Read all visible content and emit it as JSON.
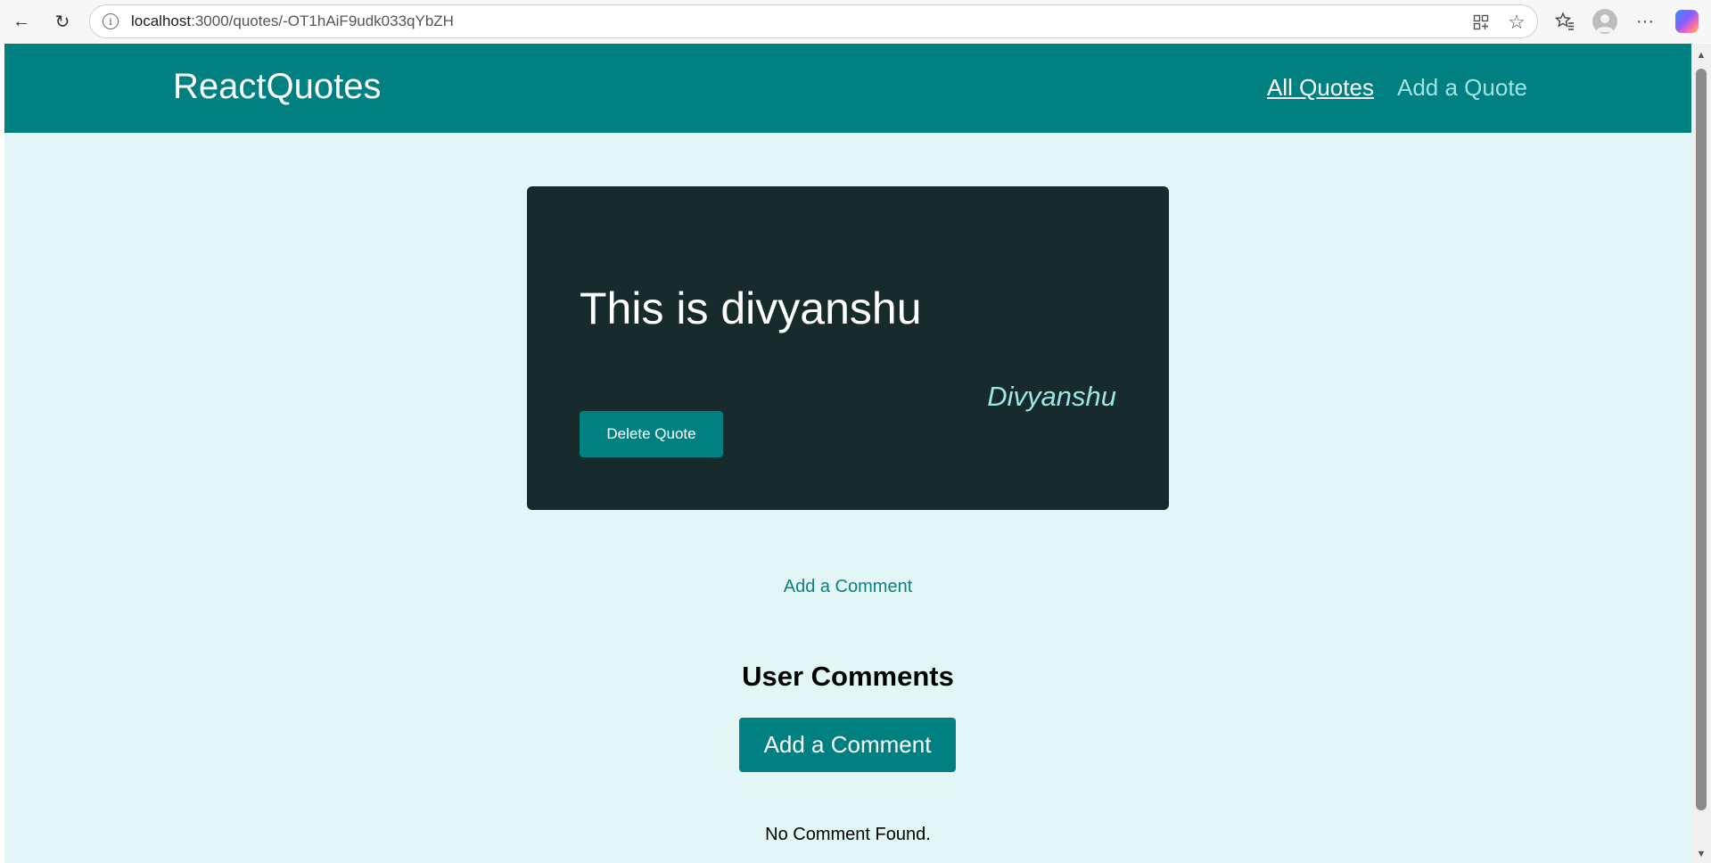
{
  "browser": {
    "url_host": "localhost",
    "url_path": ":3000/quotes/-OT1hAiF9udk033qYbZH",
    "back_glyph": "←",
    "refresh_glyph": "↻",
    "info_glyph": "i",
    "star_glyph": "☆",
    "more_glyph": "···"
  },
  "header": {
    "logo": "ReactQuotes",
    "nav": {
      "all_quotes": "All Quotes",
      "add_quote": "Add a Quote"
    }
  },
  "quote": {
    "text": "This is divyanshu",
    "author": "Divyanshu",
    "delete_label": "Delete Quote"
  },
  "comments": {
    "add_link": "Add a Comment",
    "heading": "User Comments",
    "add_button": "Add a Comment",
    "empty_message": "No Comment Found."
  },
  "colors": {
    "primary": "#008080",
    "background": "#e3f6f6",
    "card": "#172a2c",
    "author": "#9fe4e4"
  }
}
